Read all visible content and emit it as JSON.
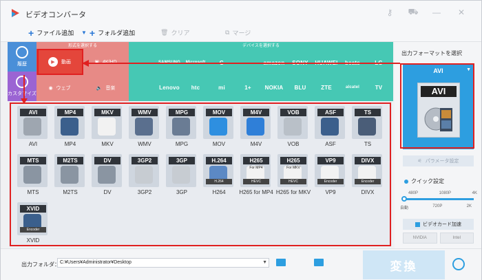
{
  "app": {
    "title": "ビデオコンバータ"
  },
  "toolbar": {
    "add_file": "ファイル追加",
    "add_folder": "フォルダ追加",
    "clear": "クリア",
    "merge": "マージ"
  },
  "rail": {
    "history": "履歴",
    "customize": "カスタマイズ"
  },
  "category": {
    "header": "形式を選択する",
    "video": "動画",
    "hd": "4K/HD",
    "web": "ウェブ",
    "audio": "音楽"
  },
  "devices": {
    "header": "デバイスを選択する",
    "row1": [
      "",
      "SAMSUNG",
      "Microsoft",
      "G",
      "",
      "amazon",
      "SONY",
      "HUAWEI",
      "beats",
      "LG"
    ],
    "row2": [
      "",
      "Lenovo",
      "htc",
      "mi",
      "1+",
      "NOKIA",
      "BLU",
      "ZTE",
      "alcatel",
      "TV"
    ]
  },
  "formats": [
    {
      "badge": "AVI",
      "label": "AVI",
      "color": "#9ea6b0"
    },
    {
      "badge": "MP4",
      "label": "MP4",
      "color": "#3b5f8c"
    },
    {
      "badge": "MKV",
      "label": "MKV",
      "color": "#f2f2f2"
    },
    {
      "badge": "WMV",
      "label": "WMV",
      "color": "#5a6f8e"
    },
    {
      "badge": "MPG",
      "label": "MPG",
      "color": "#6a7c94"
    },
    {
      "badge": "MOV",
      "label": "MOV",
      "color": "#2e8fe0"
    },
    {
      "badge": "M4V",
      "label": "M4V",
      "color": "#2f7fd8"
    },
    {
      "badge": "VOB",
      "label": "VOB",
      "color": "#b9c0c8"
    },
    {
      "badge": "ASF",
      "label": "ASF",
      "color": "#3b5f8c"
    },
    {
      "badge": "TS",
      "label": "TS",
      "color": "#4a5d78"
    },
    {
      "badge": "MTS",
      "label": "MTS",
      "color": "#8a95a2"
    },
    {
      "badge": "M2TS",
      "label": "M2TS",
      "color": "#8a95a2"
    },
    {
      "badge": "DV",
      "label": "DV",
      "color": "#8a95a2"
    },
    {
      "badge": "3GP2",
      "label": "3GP2",
      "color": "#c7ccd2"
    },
    {
      "badge": "3GP",
      "label": "3GP",
      "color": "#c7ccd2"
    },
    {
      "badge": "H.264",
      "label": "H264",
      "color": "#5c89c4",
      "sub": "H.264"
    },
    {
      "badge": "H265",
      "label": "H265 for MP4",
      "color": "#f2f2f2",
      "sub": "HEVC",
      "note": "For MP4"
    },
    {
      "badge": "H265",
      "label": "H265 for MKV",
      "color": "#f2f2f2",
      "sub": "HEVC",
      "note": "For MKV"
    },
    {
      "badge": "VP9",
      "label": "VP9",
      "color": "#f2f2f2",
      "sub": "Encoder"
    },
    {
      "badge": "DIVX",
      "label": "DIVX",
      "color": "#f2f2f2",
      "sub": "Encoder"
    },
    {
      "badge": "XVID",
      "label": "XVID",
      "color": "#3b5f8c",
      "sub": "Encoder"
    }
  ],
  "output": {
    "title": "出力フォーマットを選択",
    "format": "AVI",
    "param_button": "パラメータ設定",
    "quick_setting": "クイック設定",
    "res_top": [
      "480P",
      "1080P",
      "4K"
    ],
    "res_bottom": [
      "自動",
      "720P",
      "2K"
    ],
    "gpu_button": "ビデオカード加速",
    "chips": [
      "NVIDIA",
      "Intel"
    ]
  },
  "bottom": {
    "folder_label": "出力フォルダ：",
    "folder_path": "C:¥Users¥Administrator¥Desktop",
    "convert": "変換"
  },
  "colors": {
    "accent": "#2d9ee0",
    "highlight": "#e02020",
    "category": "#e78a86",
    "devices": "#46c8b4"
  }
}
